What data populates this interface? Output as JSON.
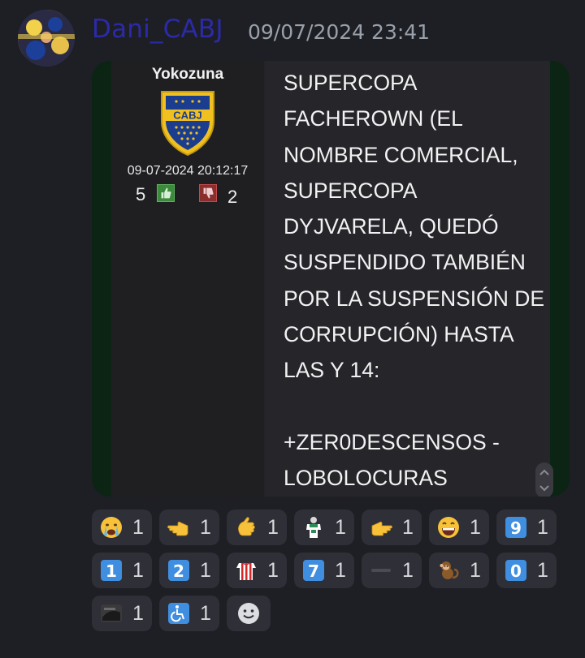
{
  "message": {
    "author": "Dani_CABJ",
    "timestamp": "09/07/2024 23:41"
  },
  "embed": {
    "user": "Yokozuna",
    "post_date": "09-07-2024 20:12:17",
    "likes": "5",
    "dislikes": "2",
    "text": "SUPERCOPA\nFACHEROWN (EL\nNOMBRE COMERCIAL,\nSUPERCOPA\nDYJVARELA, QUEDÓ\nSUSPENDIDO TAMBIÉN\nPOR LA SUSPENSIÓN DE\nCORRUPCIÓN) HASTA\nLAS Y 14:\n\n+ZER0DESCENSOS -\nLOBOLOCURAS"
  },
  "reactions": [
    {
      "icon": "crying-face-icon",
      "count": "1"
    },
    {
      "icon": "pointing-left-icon",
      "count": "1"
    },
    {
      "icon": "pointing-hand-icon",
      "count": "1"
    },
    {
      "icon": "jersey-figure-icon",
      "count": "1"
    },
    {
      "icon": "pointing-right-hand-icon",
      "count": "1"
    },
    {
      "icon": "grinning-face-icon",
      "count": "1"
    },
    {
      "icon": "keycap-9-icon",
      "count": "1",
      "key": "9"
    },
    {
      "icon": "keycap-1-icon",
      "count": "1",
      "key": "1"
    },
    {
      "icon": "keycap-2-icon",
      "count": "1",
      "key": "2"
    },
    {
      "icon": "striped-jersey-icon",
      "count": "1"
    },
    {
      "icon": "keycap-7-icon",
      "count": "1",
      "key": "7"
    },
    {
      "icon": "dash-icon",
      "count": "1"
    },
    {
      "icon": "monkey-icon",
      "count": "1"
    },
    {
      "icon": "keycap-0-icon",
      "count": "1",
      "key": "0"
    },
    {
      "icon": "dark-image-icon",
      "count": "1"
    },
    {
      "icon": "wheelchair-icon",
      "count": "1"
    }
  ],
  "add_reaction_icon": "add-reaction-smiley-icon",
  "colors": {
    "background": "#1e1f24",
    "author": "#2b2aa8",
    "timestamp": "#9aa0aa",
    "reaction_chip": "#2e2f37",
    "embed_border": "#0b2414"
  }
}
